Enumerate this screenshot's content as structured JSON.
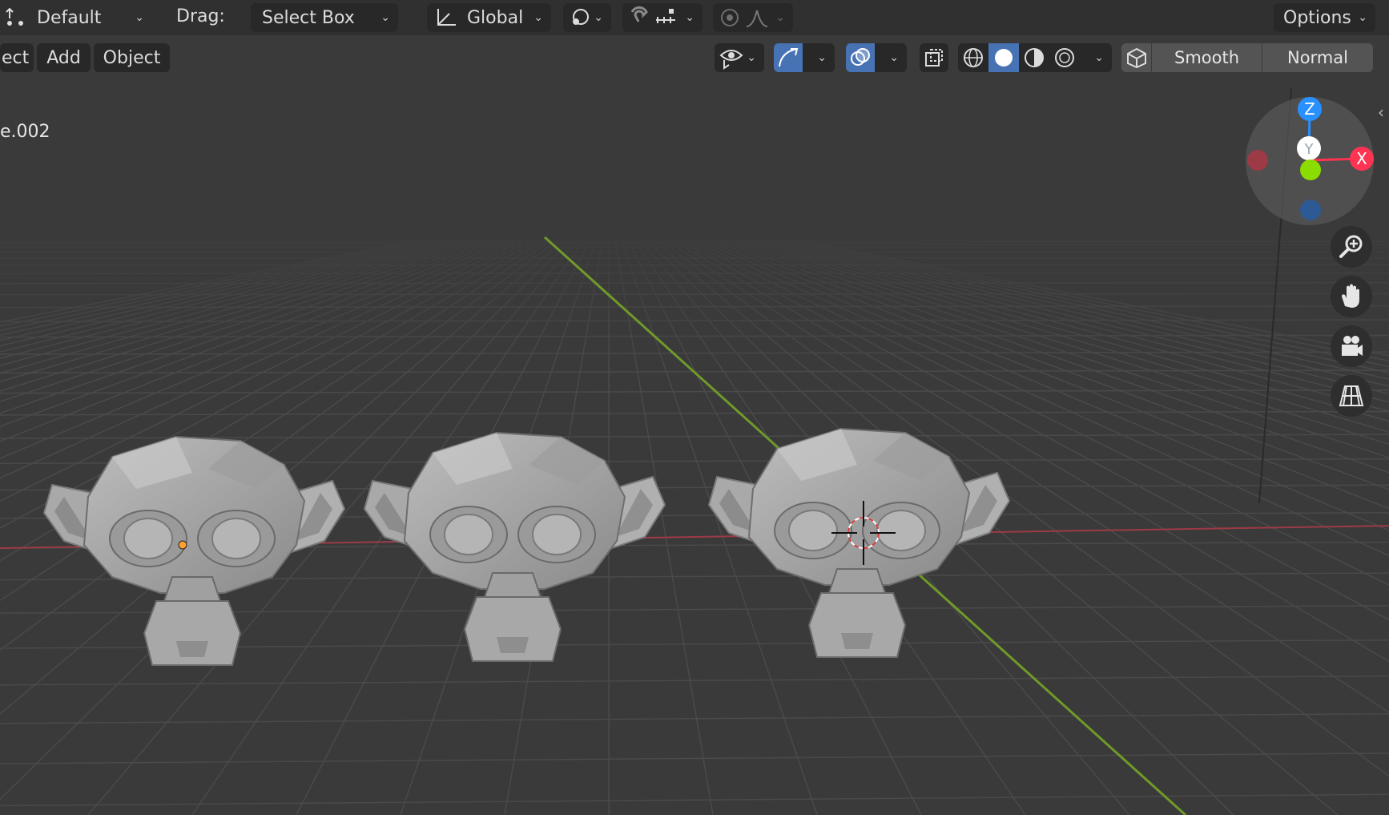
{
  "toolbar": {
    "orientation_value": "Default",
    "drag_label": "Drag:",
    "drag_value": "Select Box",
    "transform_value": "Global",
    "options_label": "Options"
  },
  "menu": {
    "select_partial": "ect",
    "add_label": "Add",
    "object_label": "Object"
  },
  "shading": {
    "smooth_label": "Smooth",
    "normal_label": "Normal"
  },
  "viewport": {
    "object_name_partial": "e.002"
  },
  "gizmo": {
    "z_label": "Z",
    "x_label": "X",
    "y_label": "Y"
  },
  "colors": {
    "x_axis": "#ff3352",
    "y_axis": "#8bdc00",
    "z_axis": "#2890ff",
    "accent_active": "#4772b3",
    "origin_dot": "#ffa033"
  },
  "icons": [
    "transform-pivot-icon",
    "chevron-down-icon",
    "orientation-axes-icon",
    "link-icon",
    "snap-magnet-icon",
    "snap-increment-icon",
    "proportional-edit-icon",
    "falloff-curve-icon",
    "visibility-eye-icon",
    "gizmo-arrow-icon",
    "overlays-icon",
    "xray-icon",
    "wireframe-shading-icon",
    "solid-shading-icon",
    "material-shading-icon",
    "rendered-shading-icon",
    "cube-icon",
    "zoom-icon",
    "hand-pan-icon",
    "camera-icon",
    "grid-perspective-icon",
    "collapse-arrow-icon"
  ]
}
